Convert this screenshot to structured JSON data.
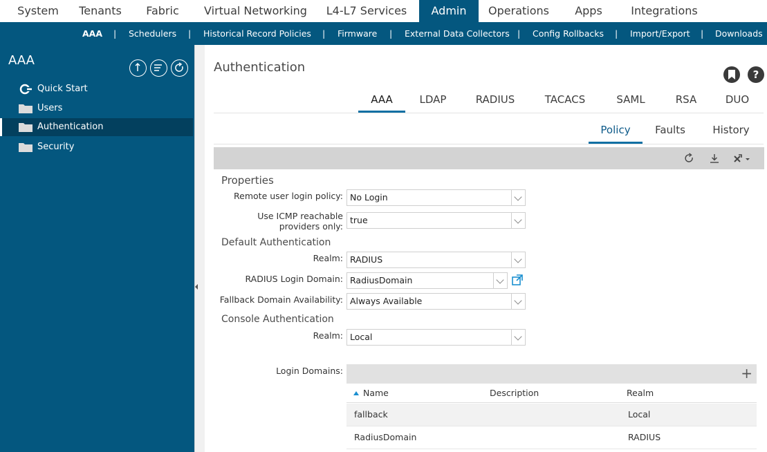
{
  "topnav": [
    {
      "label": "System"
    },
    {
      "label": "Tenants"
    },
    {
      "label": "Fabric"
    },
    {
      "label": "Virtual Networking"
    },
    {
      "label": "L4-L7 Services"
    },
    {
      "label": "Admin",
      "active": true
    },
    {
      "label": "Operations"
    },
    {
      "label": "Apps"
    },
    {
      "label": "Integrations"
    }
  ],
  "subnav": {
    "items": [
      {
        "label": "AAA",
        "active": true
      },
      {
        "label": "Schedulers"
      },
      {
        "label": "Historical Record Policies"
      },
      {
        "label": "Firmware"
      },
      {
        "label": "External Data Collectors"
      },
      {
        "label": "Config Rollbacks"
      },
      {
        "label": "Import/Export"
      },
      {
        "label": "Downloads"
      }
    ],
    "separator": "|"
  },
  "sidebar": {
    "title": "AAA",
    "items": [
      {
        "label": "Quick Start",
        "icon": "quick-start-icon"
      },
      {
        "label": "Users",
        "icon": "folder-icon"
      },
      {
        "label": "Authentication",
        "icon": "folder-icon",
        "active": true
      },
      {
        "label": "Security",
        "icon": "folder-icon"
      }
    ]
  },
  "main": {
    "title": "Authentication",
    "help_label": "?",
    "tabs": [
      {
        "label": "AAA",
        "active": true
      },
      {
        "label": "LDAP"
      },
      {
        "label": "RADIUS"
      },
      {
        "label": "TACACS"
      },
      {
        "label": "SAML"
      },
      {
        "label": "RSA"
      },
      {
        "label": "DUO"
      }
    ],
    "subtabs": [
      {
        "label": "Policy",
        "active": true
      },
      {
        "label": "Faults"
      },
      {
        "label": "History"
      }
    ]
  },
  "form": {
    "properties_title": "Properties",
    "remote_login_label": "Remote user login policy:",
    "remote_login_value": "No Login",
    "icmp_label_line1": "Use ICMP reachable",
    "icmp_label_line2": "providers only:",
    "icmp_value": "true",
    "default_auth_title": "Default Authentication",
    "realm_label": "Realm:",
    "realm_value": "RADIUS",
    "radius_domain_label": "RADIUS Login Domain:",
    "radius_domain_value": "RadiusDomain",
    "fallback_label": "Fallback Domain Availability:",
    "fallback_value": "Always Available",
    "console_auth_title": "Console Authentication",
    "console_realm_label": "Realm:",
    "console_realm_value": "Local",
    "login_domains_label": "Login Domains:"
  },
  "login_domains": {
    "add_label": "+",
    "columns": [
      "Name",
      "Description",
      "Realm"
    ],
    "rows": [
      {
        "name": "fallback",
        "description": "",
        "realm": "Local"
      },
      {
        "name": "RadiusDomain",
        "description": "",
        "realm": "RADIUS"
      }
    ]
  },
  "colors": {
    "brand": "#04577f",
    "sidebar_active": "#03405e",
    "tab_accent": "#0d6fa3",
    "link_icon": "#1a8fd0"
  }
}
